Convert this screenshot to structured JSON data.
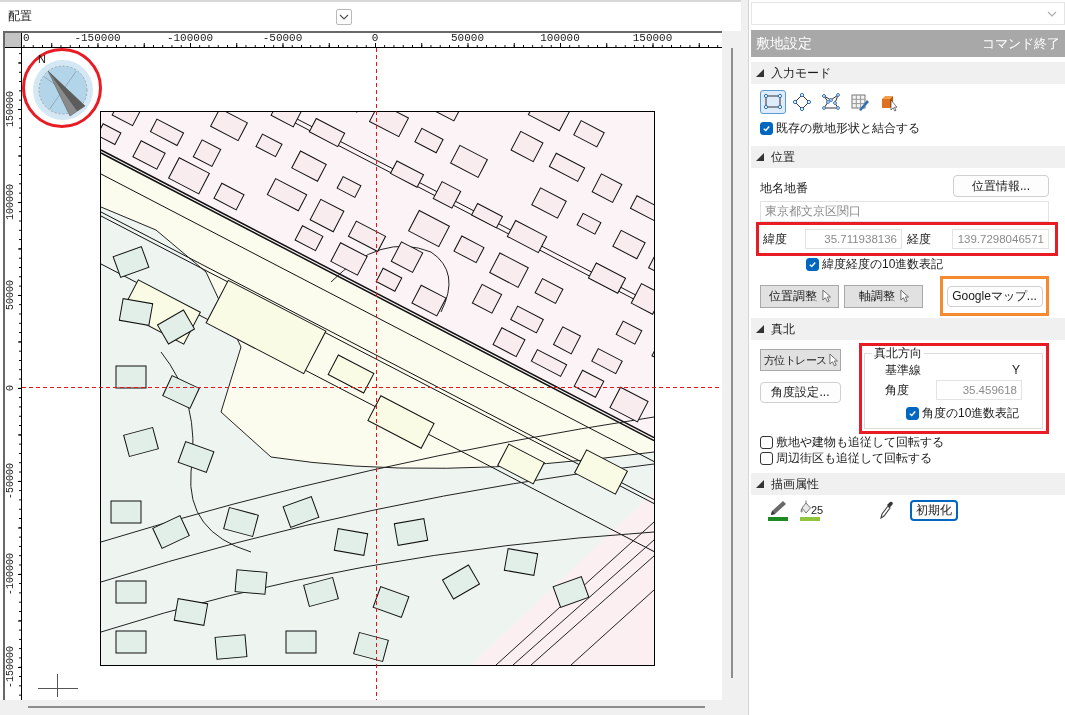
{
  "left_pane": {
    "title": "配置"
  },
  "canvas": {
    "x_ruler": {
      "origin": "0",
      "labels": [
        "-150000",
        "-100000",
        "-50000",
        "0",
        "50000",
        "100000",
        "150000"
      ]
    },
    "y_ruler": {
      "labels": [
        "150000",
        "100000",
        "50000",
        "0",
        "-50000",
        "-100000",
        "-150000"
      ]
    },
    "compass": {
      "north_label": "N",
      "highlight": {
        "color": "#e81c24"
      }
    }
  },
  "panel": {
    "header": {
      "title": "敷地設定",
      "action": "コマンド終了"
    },
    "input_mode": {
      "title": "入力モード",
      "expanded": true,
      "tools": [
        {
          "kind": "rectangle",
          "selected": true
        },
        {
          "kind": "diamond",
          "selected": false
        },
        {
          "kind": "polyline",
          "selected": false
        },
        {
          "kind": "grid",
          "selected": false
        },
        {
          "kind": "cube",
          "selected": false
        }
      ],
      "merge_checkbox": {
        "label": "既存の敷地形状と結合する",
        "checked": true
      }
    },
    "position": {
      "title": "位置",
      "expanded": true,
      "address_label": "地名地番",
      "info_button": {
        "label": "位置情報...",
        "cursor": false
      },
      "address_field": {
        "value": "東京都文京区関口",
        "readonly": true
      },
      "coords": {
        "highlight": {
          "color": "#e81c24"
        },
        "latitude_label": "緯度",
        "latitude": {
          "value": "35.711938136",
          "readonly": true
        },
        "longitude_label": "経度",
        "longitude": {
          "value": "139.7298046571",
          "readonly": true
        }
      },
      "decimal_checkbox": {
        "label": "緯度経度の10進数表記",
        "checked": true
      },
      "buttons": [
        {
          "label": "位置調整",
          "cursor": true
        },
        {
          "label": "軸調整",
          "cursor": true
        }
      ],
      "map_button": {
        "label": "Googleマップ...",
        "cursor": false,
        "highlight": {
          "color": "#f68a2e"
        }
      }
    },
    "true_north": {
      "title": "真北",
      "expanded": true,
      "buttons": [
        {
          "label": "方位トレース",
          "cursor": true
        },
        {
          "label": "角度設定...",
          "cursor": false
        }
      ],
      "direction_group": {
        "title": "真北方向",
        "highlight": {
          "color": "#e81c24"
        },
        "baseline_label": "基準線",
        "baseline_value": "Y",
        "angle_label": "角度",
        "angle_field": {
          "value": "35.459618",
          "readonly": true
        },
        "decimal_checkbox": {
          "label": "角度の10進数表記",
          "checked": true
        }
      },
      "rotate_checkboxes": [
        {
          "label": "敷地や建物も追従して回転する",
          "checked": false
        },
        {
          "label": "周辺街区も追従して回転する",
          "checked": false
        }
      ]
    },
    "draw_attributes": {
      "title": "描画属性",
      "expanded": true,
      "line_color": {
        "color": "#1e8a23"
      },
      "fill_color": {
        "color": "#8fc63c",
        "label": "25"
      },
      "reset_button": {
        "label": "初期化",
        "focused": true
      }
    }
  }
}
